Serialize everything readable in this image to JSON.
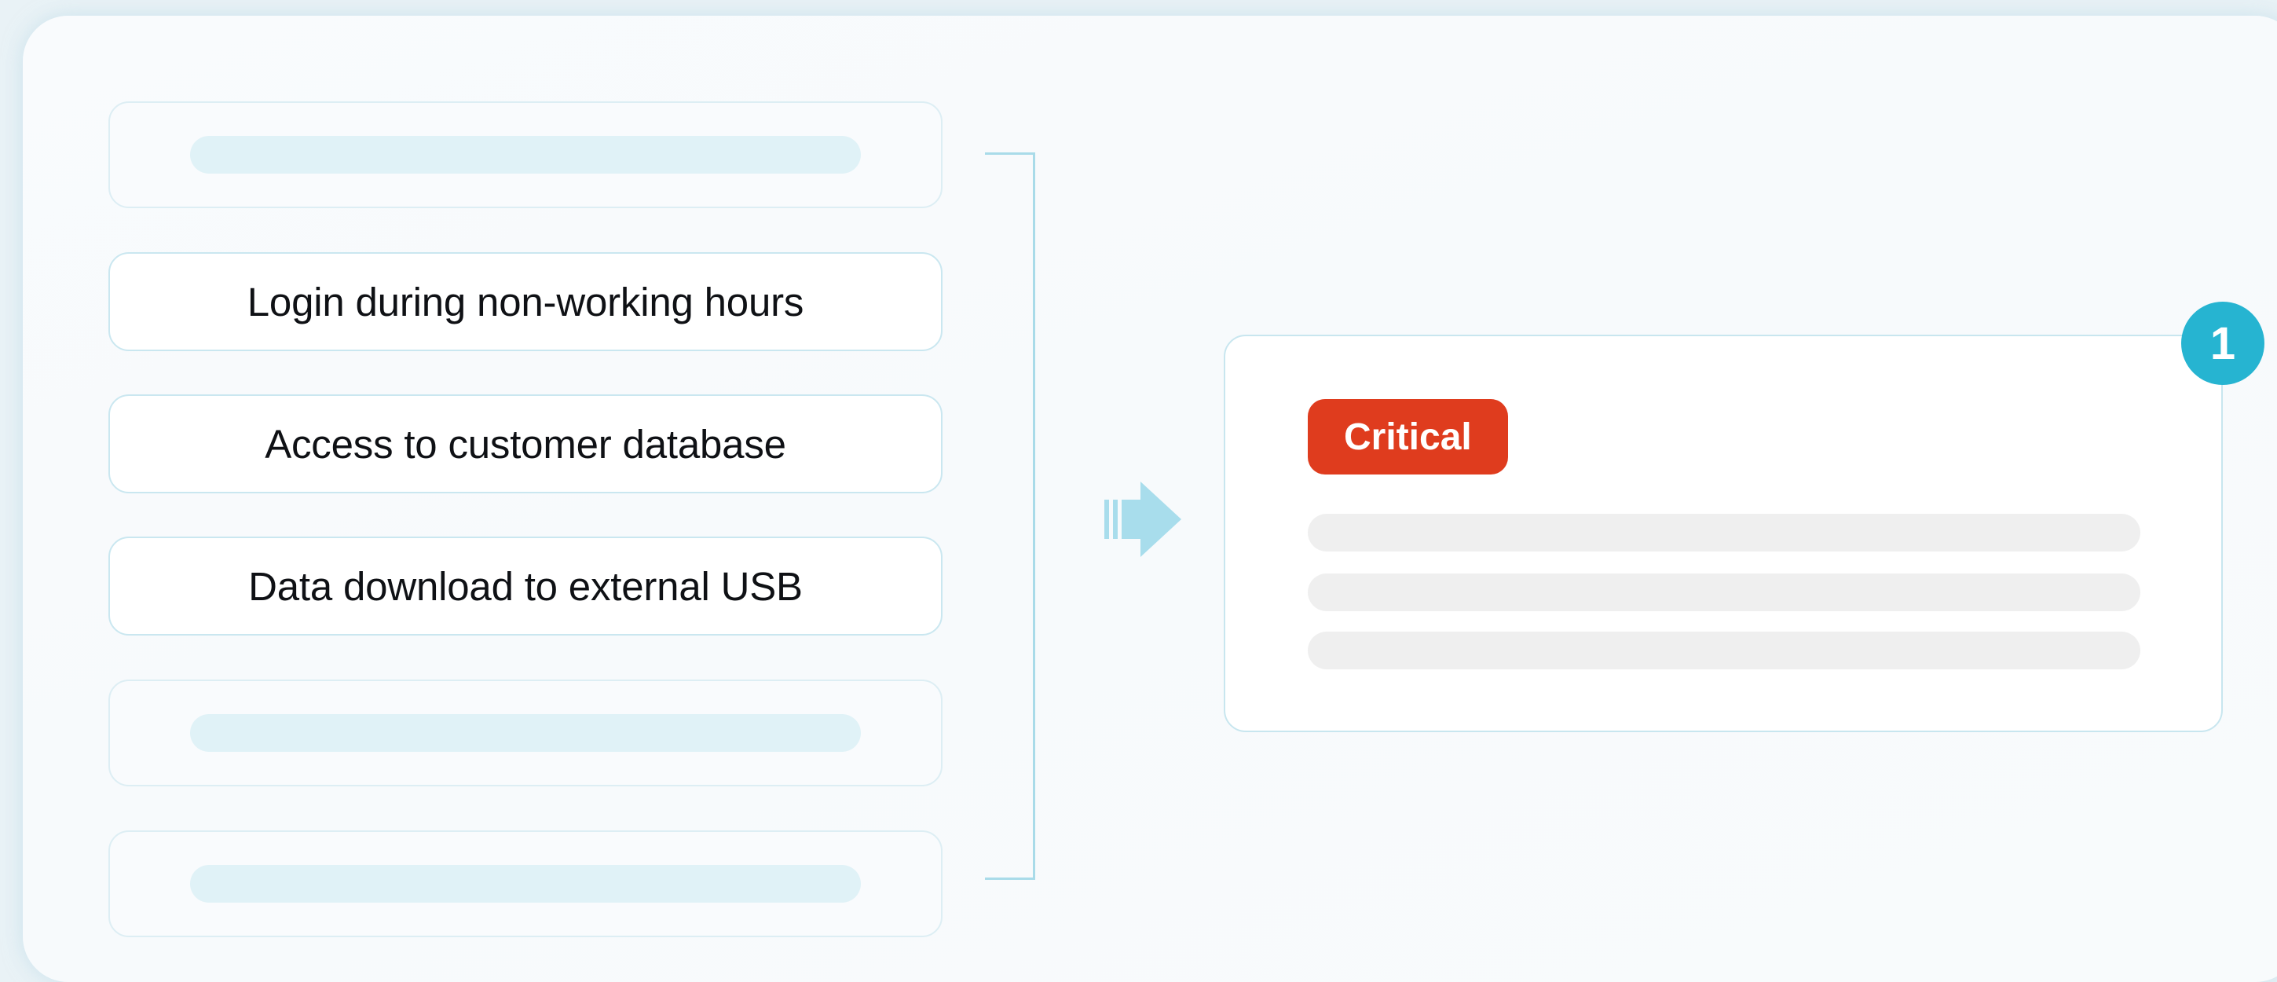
{
  "events": [
    {
      "type": "placeholder"
    },
    {
      "type": "labeled",
      "label": "Login during non-working hours"
    },
    {
      "type": "labeled",
      "label": "Access to customer database"
    },
    {
      "type": "labeled",
      "label": "Data download to external USB"
    },
    {
      "type": "placeholder"
    },
    {
      "type": "placeholder"
    }
  ],
  "result": {
    "severity": "Critical",
    "step": "1"
  },
  "colors": {
    "accent": "#26b4d1",
    "critical": "#df3c1e",
    "connector": "#a9dbe9",
    "placeholder_bar": "#e0f2f7",
    "skeleton_line": "#efefef"
  },
  "icons": {
    "flow_arrow": "arrow-right-icon"
  }
}
